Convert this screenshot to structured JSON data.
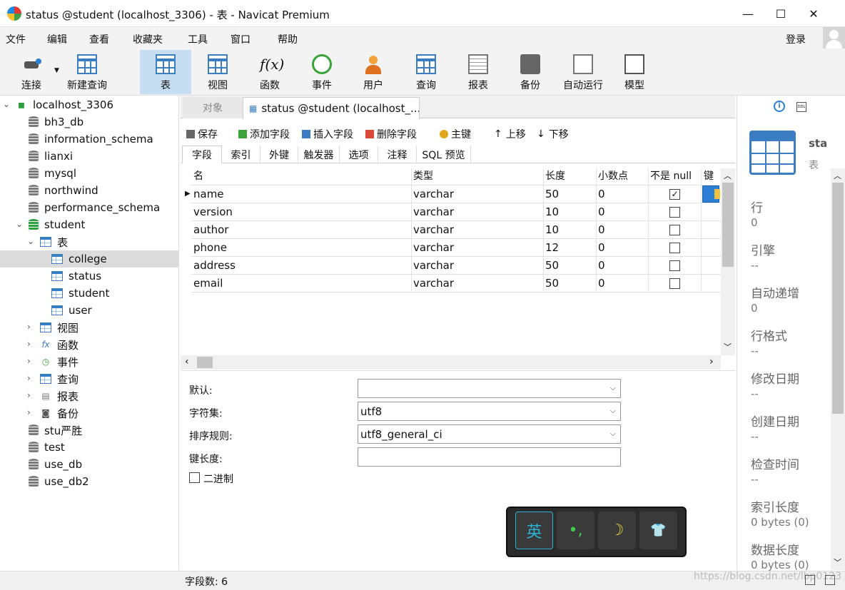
{
  "window": {
    "title": "status @student (localhost_3306) - 表 - Navicat Premium",
    "minimize": "—",
    "maximize": "☐",
    "close": "✕"
  },
  "menu": [
    "文件",
    "编辑",
    "查看",
    "收藏夹",
    "工具",
    "窗口",
    "帮助"
  ],
  "login": "登录",
  "toolbar": [
    "连接",
    "新建查询",
    "表",
    "视图",
    "函数",
    "事件",
    "用户",
    "查询",
    "报表",
    "备份",
    "自动运行",
    "模型"
  ],
  "tree": {
    "connection": "localhost_3306",
    "databases_before": [
      "bh3_db",
      "information_schema",
      "lianxi",
      "mysql",
      "northwind",
      "performance_schema"
    ],
    "open_db": "student",
    "tables_node": "表",
    "tables": [
      "college",
      "status",
      "student",
      "user"
    ],
    "groups": [
      "视图",
      "函数",
      "事件",
      "查询",
      "报表",
      "备份"
    ],
    "databases_after": [
      "stu严胜",
      "test",
      "use_db",
      "use_db2"
    ]
  },
  "tabs": {
    "objects": "对象",
    "active": "status @student (localhost_..."
  },
  "edit_toolbar": [
    "保存",
    "添加字段",
    "插入字段",
    "删除字段",
    "主键",
    "上移",
    "下移"
  ],
  "subtabs": [
    "字段",
    "索引",
    "外键",
    "触发器",
    "选项",
    "注释",
    "SQL 预览"
  ],
  "grid": {
    "headers": [
      "名",
      "类型",
      "长度",
      "小数点",
      "不是 null",
      "键"
    ],
    "rows": [
      {
        "name": "name",
        "type": "varchar",
        "length": "50",
        "decimal": "0",
        "notnull": true
      },
      {
        "name": "version",
        "type": "varchar",
        "length": "10",
        "decimal": "0",
        "notnull": false
      },
      {
        "name": "author",
        "type": "varchar",
        "length": "10",
        "decimal": "0",
        "notnull": false
      },
      {
        "name": "phone",
        "type": "varchar",
        "length": "12",
        "decimal": "0",
        "notnull": false
      },
      {
        "name": "address",
        "type": "varchar",
        "length": "50",
        "decimal": "0",
        "notnull": false
      },
      {
        "name": "email",
        "type": "varchar",
        "length": "50",
        "decimal": "0",
        "notnull": false
      }
    ]
  },
  "props": {
    "default_label": "默认:",
    "default_value": "",
    "charset_label": "字符集:",
    "charset_value": "utf8",
    "collation_label": "排序规则:",
    "collation_value": "utf8_general_ci",
    "keylen_label": "键长度:",
    "keylen_value": "",
    "binary_label": "二进制"
  },
  "ime": {
    "lang": "英",
    "punct": "•,",
    "moon": "☽",
    "skin": "👕"
  },
  "statusbar": {
    "fields": "字段数: 6",
    "watermark": "https://blog.csdn.net/lbp0123"
  },
  "right_panel": {
    "title": "sta",
    "subtitle": "表",
    "items": [
      {
        "label": "行",
        "value": "0"
      },
      {
        "label": "引擎",
        "value": "--"
      },
      {
        "label": "自动递增",
        "value": "0"
      },
      {
        "label": "行格式",
        "value": "--"
      },
      {
        "label": "修改日期",
        "value": "--"
      },
      {
        "label": "创建日期",
        "value": "--"
      },
      {
        "label": "检查时间",
        "value": "--"
      },
      {
        "label": "索引长度",
        "value": "0 bytes (0)"
      },
      {
        "label": "数据长度",
        "value": "0 bytes (0)"
      }
    ]
  }
}
